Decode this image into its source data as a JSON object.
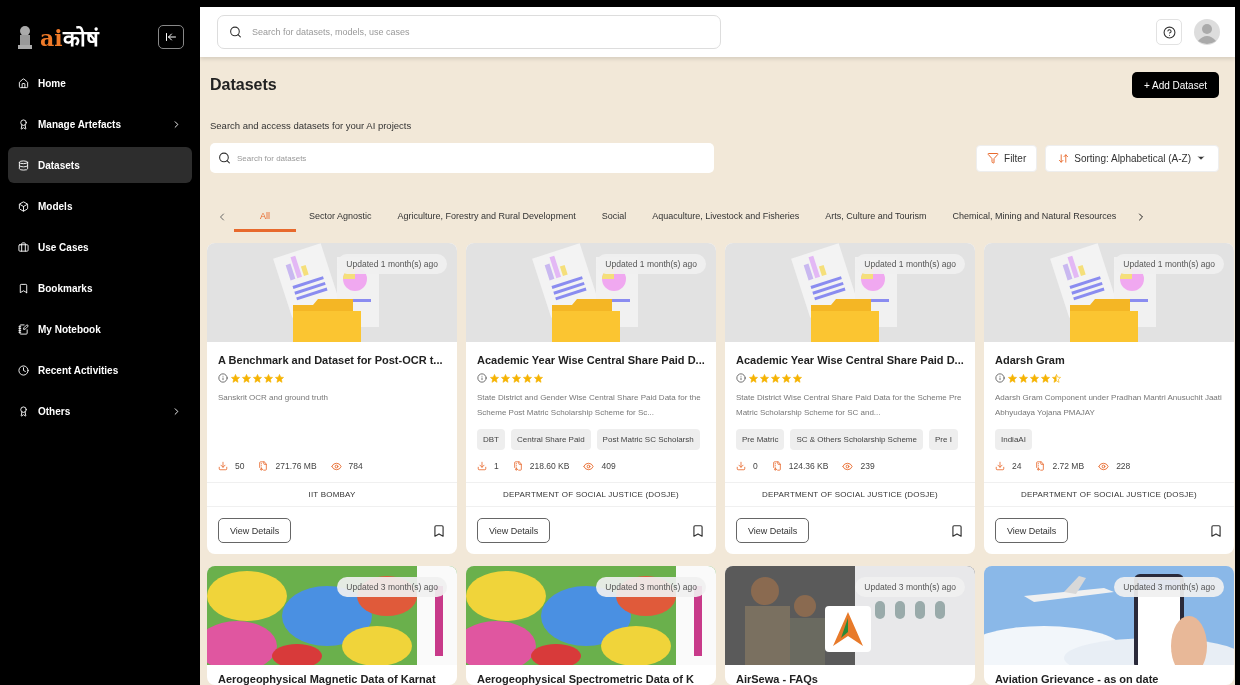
{
  "logo": {
    "prefix": "ai",
    "suffix": "कोषं"
  },
  "sidebar": {
    "items": [
      {
        "label": "Home",
        "selected": false,
        "has_submenu": false
      },
      {
        "label": "Manage Artefacts",
        "selected": false,
        "has_submenu": true
      },
      {
        "label": "Datasets",
        "selected": true,
        "has_submenu": false
      },
      {
        "label": "Models",
        "selected": false,
        "has_submenu": false
      },
      {
        "label": "Use Cases",
        "selected": false,
        "has_submenu": false
      },
      {
        "label": "Bookmarks",
        "selected": false,
        "has_submenu": false
      },
      {
        "label": "My Notebook",
        "selected": false,
        "has_submenu": false
      },
      {
        "label": "Recent Activities",
        "selected": false,
        "has_submenu": false
      },
      {
        "label": "Others",
        "selected": false,
        "has_submenu": true
      }
    ]
  },
  "header": {
    "search_placeholder": "Search for datasets, models, use cases"
  },
  "page": {
    "title": "Datasets",
    "subtitle": "Search and access datasets for your AI projects",
    "add_button": "+ Add Dataset",
    "search_placeholder": "Search for datasets",
    "filter_button": "Filter",
    "sorting_label": "Sorting:",
    "sorting_value": "Alphabetical (A-Z)"
  },
  "tabs": [
    {
      "label": "All",
      "selected": true
    },
    {
      "label": "Sector Agnostic",
      "selected": false
    },
    {
      "label": "Agriculture, Forestry and Rural Development",
      "selected": false
    },
    {
      "label": "Social",
      "selected": false
    },
    {
      "label": "Aquaculture, Livestock and Fisheries",
      "selected": false
    },
    {
      "label": "Arts, Culture and Tourism",
      "selected": false
    },
    {
      "label": "Chemical, Mining and Natural Resources",
      "selected": false
    }
  ],
  "cards": [
    {
      "kind": "full",
      "updated": "Updated 1 month(s) ago",
      "title": "A Benchmark and Dataset for Post-OCR t...",
      "stars": 5,
      "description": "Sanskrit OCR and ground truth",
      "downloads": "50",
      "size": "271.76 MB",
      "views": "784",
      "organization": "IIT BOMBAY",
      "button": "View Details"
    },
    {
      "kind": "full",
      "updated": "Updated 1 month(s) ago",
      "title": "Academic Year Wise Central Share Paid D...",
      "stars": 5,
      "description": "State District and Gender Wise Central Share Paid Data for the Scheme Post Matric Scholarship Scheme for Sc...",
      "tags": [
        "DBT",
        "Central Share Paid",
        "Post Matric SC Scholarsh"
      ],
      "downloads": "1",
      "size": "218.60 KB",
      "views": "409",
      "organization": "DEPARTMENT OF SOCIAL JUSTICE (DOSJE)",
      "button": "View Details"
    },
    {
      "kind": "full",
      "updated": "Updated 1 month(s) ago",
      "title": "Academic Year Wise Central Share Paid D...",
      "stars": 5,
      "description": "State District Wise Central Share Paid Data for the Scheme Pre Matric Scholarship Scheme for SC and...",
      "tags": [
        "Pre Matric",
        "SC & Others Scholarship Scheme",
        "Pre I"
      ],
      "downloads": "0",
      "size": "124.36 KB",
      "views": "239",
      "organization": "DEPARTMENT OF SOCIAL JUSTICE (DOSJE)",
      "button": "View Details"
    },
    {
      "kind": "full",
      "updated": "Updated 1 month(s) ago",
      "title": "Adarsh Gram",
      "stars": 4.5,
      "description": "Adarsh Gram Component under Pradhan Mantri Anusuchit Jaati Abhyudaya Yojana PMAJAY",
      "tags": [
        "IndiaAI"
      ],
      "downloads": "24",
      "size": "2.72 MB",
      "views": "228",
      "organization": "DEPARTMENT OF SOCIAL JUSTICE (DOSJE)",
      "button": "View Details"
    },
    {
      "kind": "picture",
      "updated": "Updated 3 month(s) ago",
      "title": "Aerogeophysical Magnetic Data of Karnat"
    },
    {
      "kind": "picture",
      "updated": "Updated 3 month(s) ago",
      "title": "Aerogeophysical Spectrometric Data of K"
    },
    {
      "kind": "picture",
      "updated": "Updated 3 month(s) ago",
      "title": "AirSewa - FAQs"
    },
    {
      "kind": "picture",
      "updated": "Updated 3 month(s) ago",
      "title": "Aviation Grievance - as on date"
    }
  ]
}
